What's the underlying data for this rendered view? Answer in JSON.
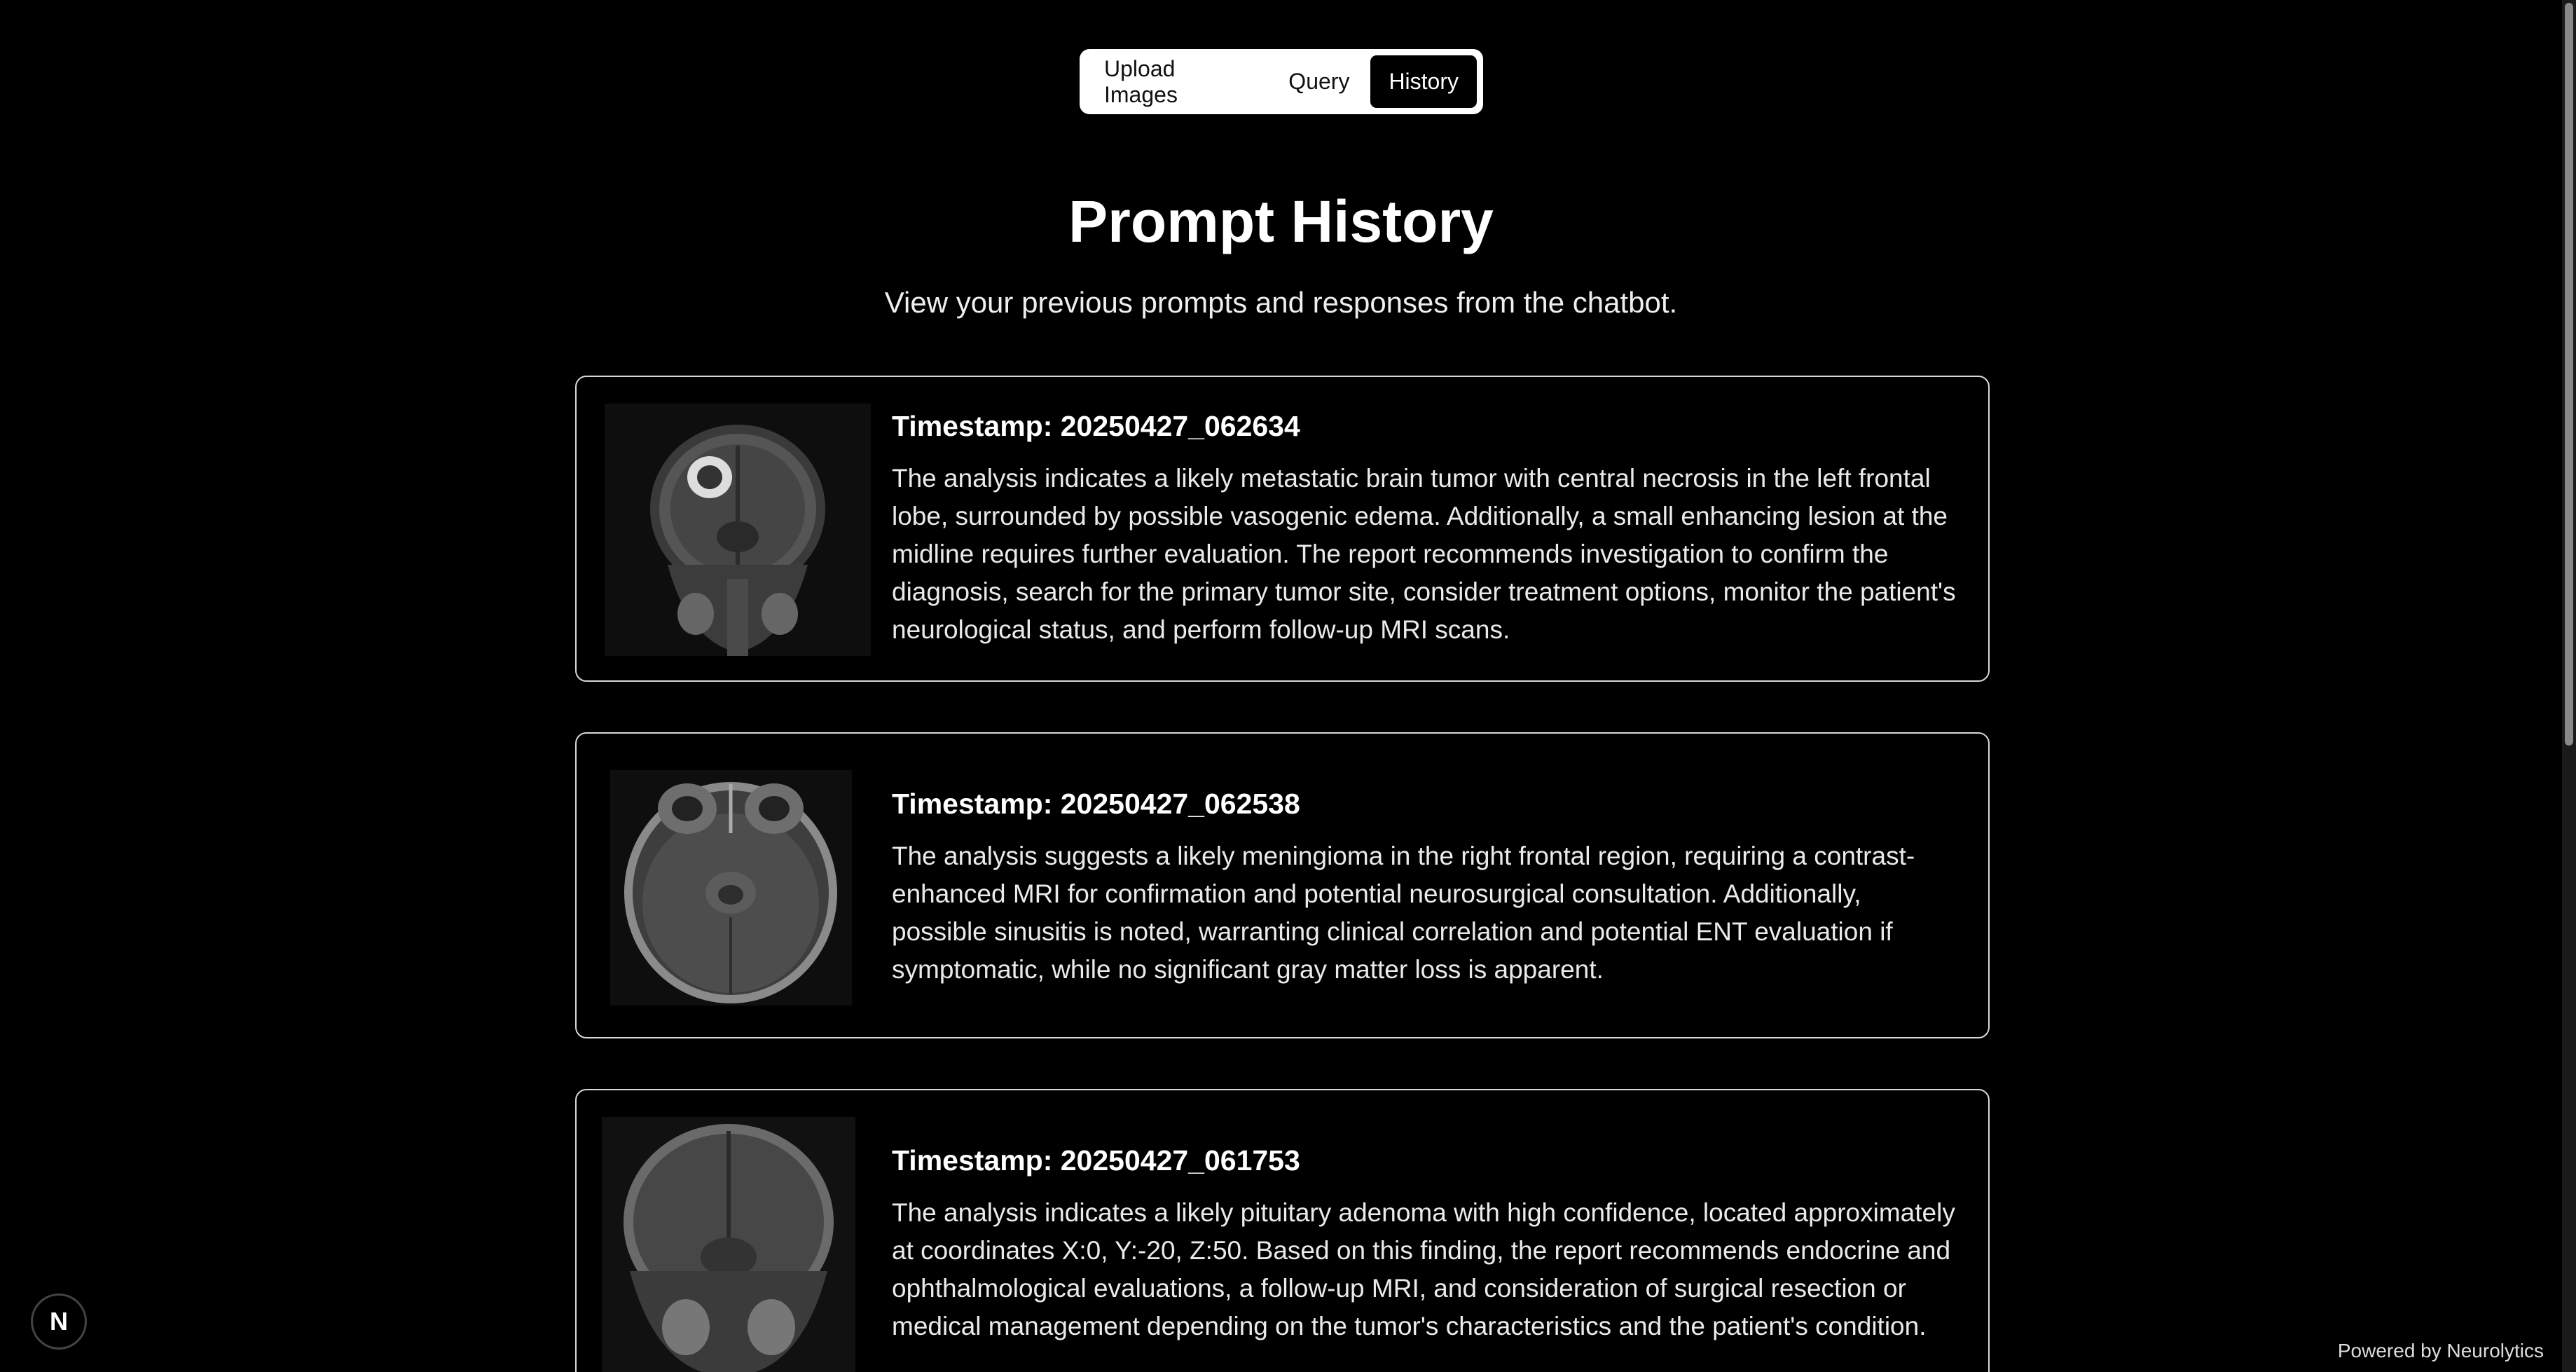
{
  "tabs": [
    {
      "label": "Upload Images",
      "active": false
    },
    {
      "label": "Query",
      "active": false
    },
    {
      "label": "History",
      "active": true
    }
  ],
  "page": {
    "title": "Prompt History",
    "subtitle": "View your previous prompts and responses from the chatbot."
  },
  "entries": [
    {
      "timestamp": "Timestamp: 20250427_062634",
      "text": "The analysis indicates a likely metastatic brain tumor with central necrosis in the left frontal lobe, surrounded by possible vasogenic edema. Additionally, a small enhancing lesion at the midline requires further evaluation. The report recommends investigation to confirm the diagnosis, search for the primary tumor site, consider treatment options, monitor the patient's neurological status, and perform follow-up MRI scans.",
      "image": "brain-mri-coronal"
    },
    {
      "timestamp": "Timestamp: 20250427_062538",
      "text": "The analysis suggests a likely meningioma in the right frontal region, requiring a contrast-enhanced MRI for confirmation and potential neurosurgical consultation. Additionally, possible sinusitis is noted, warranting clinical correlation and potential ENT evaluation if symptomatic, while no significant gray matter loss is apparent.",
      "image": "brain-mri-axial"
    },
    {
      "timestamp": "Timestamp: 20250427_061753",
      "text": "The analysis indicates a likely pituitary adenoma with high confidence, located approximately at coordinates X:0, Y:-20, Z:50. Based on this finding, the report recommends endocrine and ophthalmological evaluations, a follow-up MRI, and consideration of surgical resection or medical management depending on the tumor's characteristics and the patient's condition.",
      "image": "brain-mri-coronal"
    }
  ],
  "footer": {
    "badge_letter": "N",
    "powered_by": "Powered by Neurolytics"
  }
}
